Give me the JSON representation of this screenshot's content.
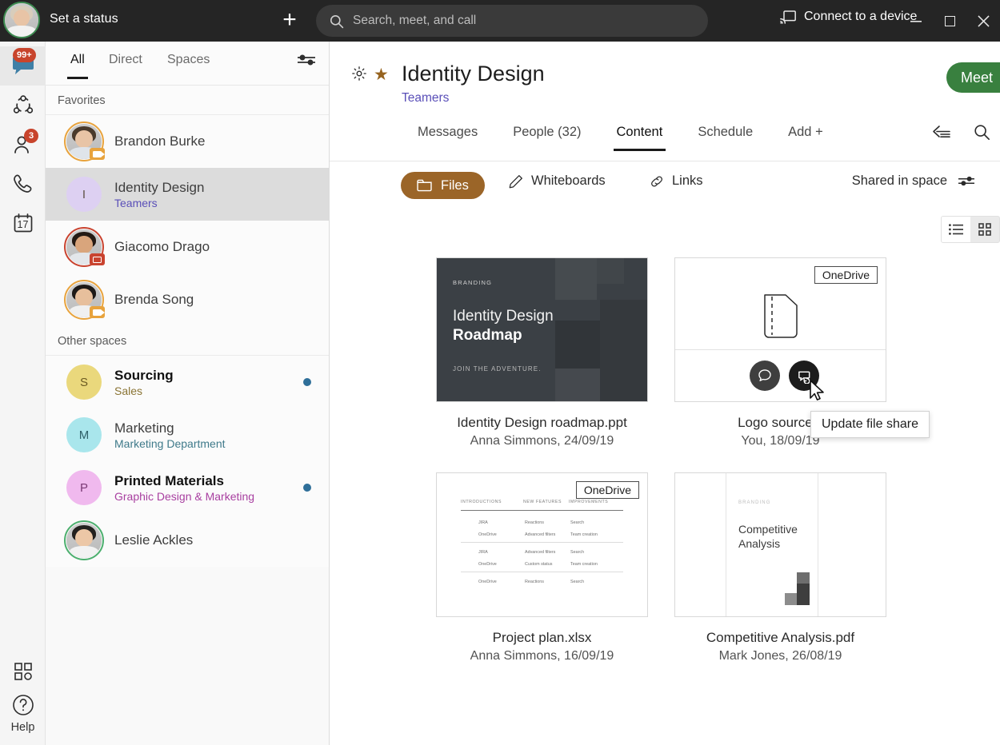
{
  "topbar": {
    "status_label": "Set a status",
    "add_label": "+",
    "search_placeholder": "Search, meet, and call",
    "connect_label": "Connect to a device",
    "avatar_name": "user-avatar"
  },
  "rail": {
    "items": [
      {
        "name": "messages",
        "badge": "99+"
      },
      {
        "name": "spaces",
        "badge": ""
      },
      {
        "name": "contacts",
        "badge": "3"
      },
      {
        "name": "calls",
        "badge": ""
      },
      {
        "name": "calendar",
        "badge": "17"
      }
    ],
    "apps_label": "",
    "help_label": "Help"
  },
  "list": {
    "tabs": [
      {
        "label": "All",
        "active": true
      },
      {
        "label": "Direct",
        "active": false
      },
      {
        "label": "Spaces",
        "active": false
      }
    ],
    "favorites_header": "Favorites",
    "other_header": "Other spaces",
    "favorites": [
      {
        "name": "Brandon Burke",
        "sub": "",
        "initial": "",
        "selected": false,
        "unread": false
      },
      {
        "name": "Identity Design",
        "sub": "Teamers",
        "initial": "I",
        "selected": true,
        "unread": false
      },
      {
        "name": "Giacomo Drago",
        "sub": "",
        "initial": "",
        "selected": false,
        "unread": false
      },
      {
        "name": "Brenda Song",
        "sub": "",
        "initial": "",
        "selected": false,
        "unread": false
      }
    ],
    "other": [
      {
        "name": "Sourcing",
        "sub": "Sales",
        "initial": "S",
        "bold": true,
        "unread": true
      },
      {
        "name": "Marketing",
        "sub": "Marketing Department",
        "initial": "M",
        "bold": false,
        "unread": false
      },
      {
        "name": "Printed Materials",
        "sub": "Graphic Design & Marketing",
        "initial": "P",
        "bold": true,
        "unread": true
      },
      {
        "name": "Leslie Ackles",
        "sub": "",
        "initial": "",
        "bold": false,
        "unread": false
      }
    ]
  },
  "space": {
    "title": "Identity Design",
    "subtitle": "Teamers",
    "meet_label": "Meet",
    "tabs": [
      {
        "label": "Messages",
        "active": false
      },
      {
        "label": "People (32)",
        "active": false
      },
      {
        "label": "Content",
        "active": true
      },
      {
        "label": "Schedule",
        "active": false
      },
      {
        "label": "Add  +",
        "active": false
      }
    ]
  },
  "content": {
    "filters": [
      {
        "label": "Files",
        "active": true
      },
      {
        "label": "Whiteboards",
        "active": false
      },
      {
        "label": "Links",
        "active": false
      }
    ],
    "shared_label": "Shared in space",
    "tooltip": "Update file share",
    "files": [
      {
        "filename": "Identity Design roadmap.ppt",
        "meta": "Anna Simmons, 24/09/19",
        "badge": "",
        "thumb_kicker": "BRANDING",
        "thumb_title_1": "Identity Design",
        "thumb_title_2": "Roadmap",
        "thumb_footer": "JOIN THE ADVENTURE."
      },
      {
        "filename": "Logo source fi",
        "meta": "You, 18/09/19",
        "badge": "OneDrive"
      },
      {
        "filename": "Project plan.xlsx",
        "meta": "Anna Simmons, 16/09/19",
        "badge": "OneDrive",
        "table": {
          "columns": [
            "INTRODUCTIONS",
            "NEW FEATURES",
            "IMPROVEMENTS"
          ],
          "rows": [
            [
              "JIRA",
              "Reactions",
              "Search"
            ],
            [
              "OneDrive",
              "Advanced filters",
              "Team creation"
            ],
            [
              "JIRA",
              "Advanced filters",
              "Search"
            ],
            [
              "OneDrive",
              "Custom status",
              "Team creation"
            ],
            [
              "OneDrive",
              "Reactions",
              "Search"
            ]
          ]
        }
      },
      {
        "filename": "Competitive Analysis.pdf",
        "meta": "Mark Jones, 26/08/19",
        "badge": "",
        "thumb_kicker": "BRANDING",
        "thumb_title_1": "Competitive",
        "thumb_title_2": "Analysis"
      }
    ]
  },
  "colors": {
    "topbar_bg": "#252525",
    "accent_pill": "#9b6528",
    "meet_green": "#39803f",
    "unread_dot": "#2f6f99",
    "badge_red": "#c8442c",
    "star_gold": "#96631f",
    "link_purple": "#5a4fb8"
  }
}
